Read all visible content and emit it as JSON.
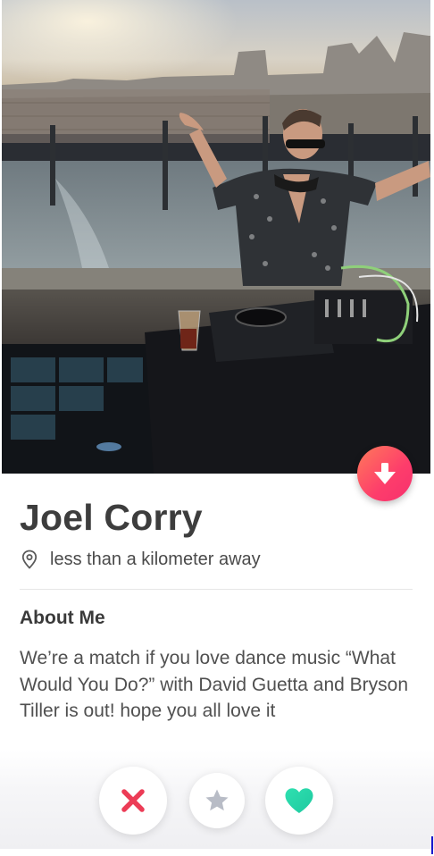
{
  "profile": {
    "name": "Joel Corry",
    "distance": "less than a kilometer away",
    "about_heading": "About Me",
    "bio": "We’re a match if you love dance music “What Would You Do?” with David Guetta and Bryson Tiller is out! hope you all love it"
  },
  "icons": {
    "collapse": "arrow-down-icon",
    "location": "map-pin-icon",
    "nope": "x-icon",
    "super_like": "star-icon",
    "like": "heart-icon"
  },
  "colors": {
    "accent": "#fd3d6b",
    "nope": "#ec3c56",
    "super_like": "#b8bcc6",
    "like": "#2ee0b0",
    "name_text": "#3d3d3d"
  }
}
